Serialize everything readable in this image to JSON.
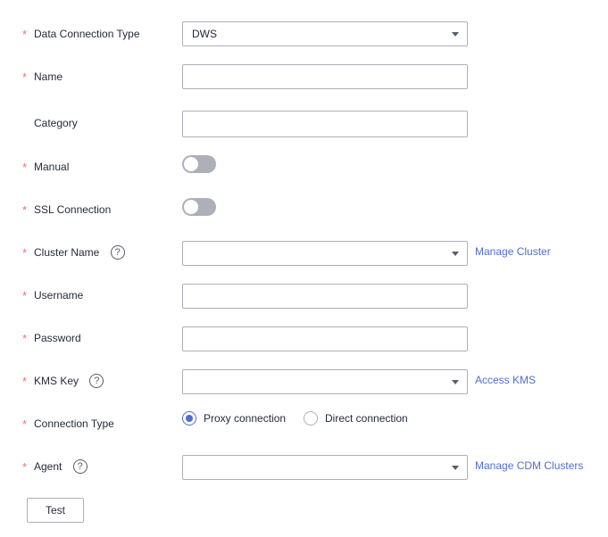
{
  "form": {
    "required_mark": "*",
    "data_connection_type": {
      "label": "Data Connection Type",
      "value": "DWS"
    },
    "name": {
      "label": "Name",
      "value": ""
    },
    "category": {
      "label": "Category",
      "value": ""
    },
    "manual": {
      "label": "Manual",
      "enabled": false
    },
    "ssl_connection": {
      "label": "SSL Connection",
      "enabled": false
    },
    "cluster_name": {
      "label": "Cluster Name",
      "value": "",
      "help_icon": "question-circle-icon",
      "link": "Manage Cluster"
    },
    "username": {
      "label": "Username",
      "value": ""
    },
    "password": {
      "label": "Password",
      "value": ""
    },
    "kms_key": {
      "label": "KMS Key",
      "value": "",
      "help_icon": "question-circle-icon",
      "link": "Access KMS"
    },
    "connection_type": {
      "label": "Connection Type",
      "options": [
        {
          "label": "Proxy connection",
          "checked": true
        },
        {
          "label": "Direct connection",
          "checked": false
        }
      ]
    },
    "agent": {
      "label": "Agent",
      "value": "",
      "help_icon": "question-circle-icon",
      "link": "Manage CDM Clusters"
    },
    "help_glyph": "?",
    "test_button": "Test"
  },
  "colors": {
    "required": "#f66f6a",
    "link": "#526ecc",
    "border": "#adb0b8",
    "toggle_off": "#adb0b8",
    "radio_checked": "#526ecc",
    "text": "#252b3a"
  }
}
